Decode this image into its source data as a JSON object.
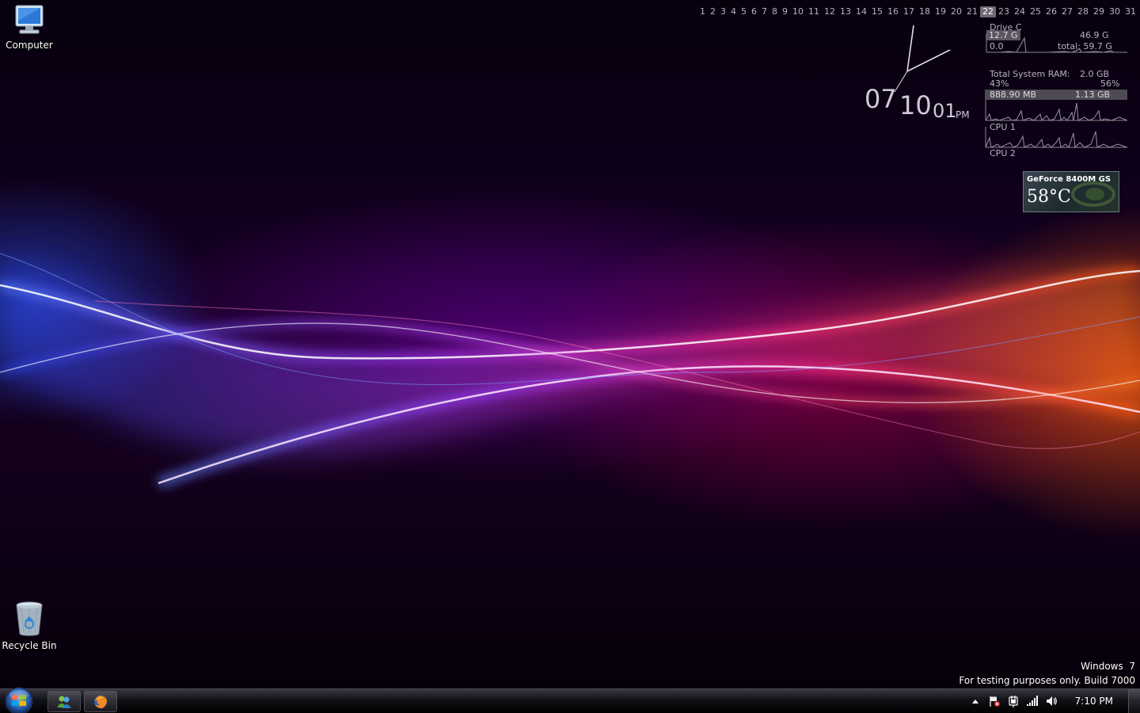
{
  "desktop": {
    "icons": [
      {
        "label": "Computer",
        "icon": "computer-icon"
      },
      {
        "label": "Recycle Bin",
        "icon": "recycle-bin-icon"
      }
    ]
  },
  "calendar": {
    "days": [
      "1",
      "2",
      "3",
      "4",
      "5",
      "6",
      "7",
      "8",
      "9",
      "10",
      "11",
      "12",
      "13",
      "14",
      "15",
      "16",
      "17",
      "18",
      "19",
      "20",
      "21",
      "22",
      "23",
      "24",
      "25",
      "26",
      "27",
      "28",
      "29",
      "30",
      "31"
    ],
    "today": "22"
  },
  "clock": {
    "hour": "07",
    "minute": "10",
    "second": "01",
    "ampm": "PM"
  },
  "sysmon": {
    "drive_label": "Drive C",
    "drive_used": "12.7 G",
    "drive_free": "46.9 G",
    "drive_rate": "0.0",
    "drive_total": "total: 59.7 G",
    "ram_label": "Total System RAM:",
    "ram_total": "2.0 GB",
    "ram_used_pct": "43%",
    "ram_free_pct": "56%",
    "ram_used": "888.90 MB",
    "ram_free": "1.13 GB",
    "cpu1_label": "CPU 1",
    "cpu2_label": "CPU 2"
  },
  "gpu": {
    "name": "GeForce 8400M GS",
    "temperature": "58°C"
  },
  "watermark": {
    "line1": "Windows  7",
    "line2": "For testing purposes only. Build 7000"
  },
  "taskbar": {
    "start_icon": "windows-orb-icon",
    "pinned": [
      {
        "icon": "windows-live-messenger-icon"
      },
      {
        "icon": "firefox-icon"
      }
    ],
    "tray_icons": [
      "show-hidden-icons-arrow",
      "action-center-flag-icon",
      "power-plug-icon",
      "network-signal-icon",
      "volume-icon"
    ],
    "time": "7:10 PM"
  },
  "colors": {
    "wave_blue": "#3a5bff",
    "wave_purple": "#b14cff",
    "wave_pink": "#ff2f8a",
    "wave_orange": "#ff6a10"
  }
}
